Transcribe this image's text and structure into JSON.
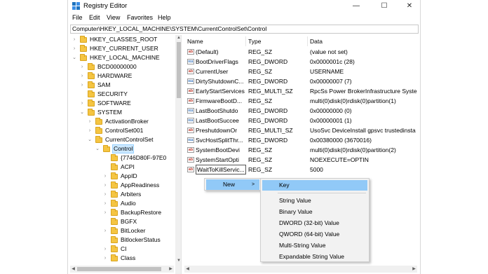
{
  "window": {
    "title": "Registry Editor",
    "minimize_glyph": "—",
    "maximize_glyph": "☐",
    "close_glyph": "✕"
  },
  "menu": {
    "file": "File",
    "edit": "Edit",
    "view": "View",
    "favorites": "Favorites",
    "help": "Help"
  },
  "address": "Computer\\HKEY_LOCAL_MACHINE\\SYSTEM\\CurrentControlSet\\Control",
  "tree": [
    {
      "label": "HKEY_CLASSES_ROOT",
      "chev": ">"
    },
    {
      "label": "HKEY_CURRENT_USER",
      "chev": ">"
    },
    {
      "label": "HKEY_LOCAL_MACHINE",
      "chev": "v"
    },
    {
      "label": "BCD00000000",
      "chev": ">"
    },
    {
      "label": "HARDWARE",
      "chev": ">"
    },
    {
      "label": "SAM",
      "chev": ">"
    },
    {
      "label": "SECURITY",
      "chev": ""
    },
    {
      "label": "SOFTWARE",
      "chev": ">"
    },
    {
      "label": "SYSTEM",
      "chev": "v"
    },
    {
      "label": "ActivationBroker",
      "chev": ">"
    },
    {
      "label": "ControlSet001",
      "chev": ">"
    },
    {
      "label": "CurrentControlSet",
      "chev": "v"
    },
    {
      "label": "Control",
      "chev": "v"
    },
    {
      "label": "{7746D80F-97E0",
      "chev": ""
    },
    {
      "label": "ACPI",
      "chev": ""
    },
    {
      "label": "AppID",
      "chev": ">"
    },
    {
      "label": "AppReadiness",
      "chev": ">"
    },
    {
      "label": "Arbiters",
      "chev": ">"
    },
    {
      "label": "Audio",
      "chev": ">"
    },
    {
      "label": "BackupRestore",
      "chev": ">"
    },
    {
      "label": "BGFX",
      "chev": ""
    },
    {
      "label": "BitLocker",
      "chev": ">"
    },
    {
      "label": "BitlockerStatus",
      "chev": ""
    },
    {
      "label": "CI",
      "chev": ">"
    },
    {
      "label": "Class",
      "chev": ">"
    }
  ],
  "list": {
    "headers": {
      "name": "Name",
      "type": "Type",
      "data": "Data"
    },
    "rows": [
      {
        "icon": "ab",
        "name": "(Default)",
        "type": "REG_SZ",
        "data": "(value not set)"
      },
      {
        "icon": "bin",
        "name": "BootDriverFlags",
        "type": "REG_DWORD",
        "data": "0x0000001c (28)"
      },
      {
        "icon": "ab",
        "name": "CurrentUser",
        "type": "REG_SZ",
        "data": "USERNAME"
      },
      {
        "icon": "bin",
        "name": "DirtyShutdownC...",
        "type": "REG_DWORD",
        "data": "0x00000007 (7)"
      },
      {
        "icon": "ab",
        "name": "EarlyStartServices",
        "type": "REG_MULTI_SZ",
        "data": "RpcSs Power BrokerInfrastructure Syste"
      },
      {
        "icon": "ab",
        "name": "FirmwareBootD...",
        "type": "REG_SZ",
        "data": "multi(0)disk(0)rdisk(0)partition(1)"
      },
      {
        "icon": "bin",
        "name": "LastBootShutdo",
        "type": "REG_DWORD",
        "data": "0x00000000 (0)"
      },
      {
        "icon": "bin",
        "name": "LastBootSuccee",
        "type": "REG_DWORD",
        "data": "0x00000001 (1)"
      },
      {
        "icon": "ab",
        "name": "PreshutdownOr",
        "type": "REG_MULTI_SZ",
        "data": "UsoSvc DeviceInstall gpsvc trustedinsta"
      },
      {
        "icon": "bin",
        "name": "SvcHostSplitThr...",
        "type": "REG_DWORD",
        "data": "0x00380000 (3670016)"
      },
      {
        "icon": "ab",
        "name": "SystemBootDevi",
        "type": "REG_SZ",
        "data": "multi(0)disk(0)rdisk(0)partition(2)"
      },
      {
        "icon": "ab",
        "name": "SystemStartOpti",
        "type": "REG_SZ",
        "data": " NOEXECUTE=OPTIN"
      },
      {
        "icon": "ab",
        "name": "WaitToKillServic...",
        "type": "REG_SZ",
        "data": "5000"
      }
    ]
  },
  "context_menu": {
    "new_label": "New",
    "arrow": ">"
  },
  "submenu": {
    "items": [
      "Key",
      "String Value",
      "Binary Value",
      "DWORD (32-bit) Value",
      "QWORD (64-bit) Value",
      "Multi-String Value",
      "Expandable String Value"
    ]
  },
  "colors": {
    "selection": "#cce8ff",
    "menu_highlight": "#91c9f7",
    "folder": "#f5c542"
  }
}
